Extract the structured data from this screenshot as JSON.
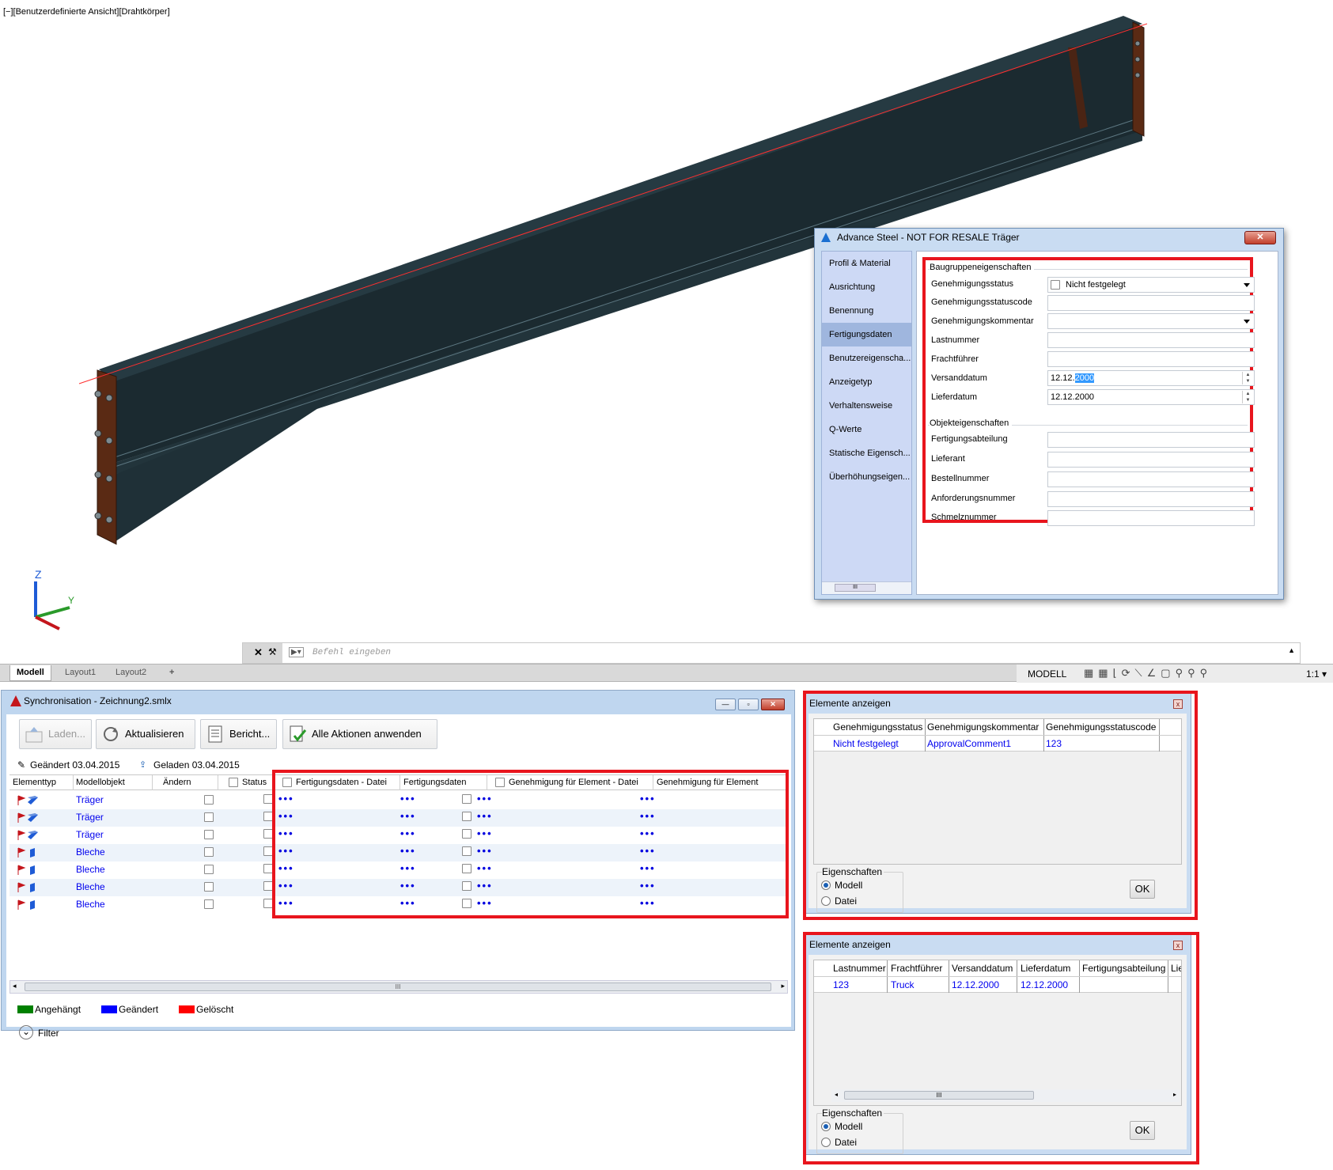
{
  "viewport": {
    "label": "[−][Benutzerdefinierte Ansicht][Drahtkörper]",
    "axis_labels": {
      "z": "Z",
      "y": "Y"
    }
  },
  "props_dialog": {
    "title": "Advance Steel - NOT FOR RESALE   Träger",
    "close": "✕",
    "nav": [
      "Profil & Material",
      "Ausrichtung",
      "Benennung",
      "Fertigungsdaten",
      "Benutzereigenscha...",
      "Anzeigetyp",
      "Verhaltensweise",
      "Q-Werte",
      "Statische Eigensch...",
      "Überhöhungseigen..."
    ],
    "nav_selected_index": 3,
    "nav_scroll_label": "III",
    "group1": "Baugruppeneigenschaften",
    "group2": "Objekteigenschaften",
    "labels": {
      "status": "Genehmigungsstatus",
      "statuscode": "Genehmigungsstatuscode",
      "comment": "Genehmigungskommentar",
      "lastnummer": "Lastnummer",
      "fracht": "Frachtführer",
      "versand": "Versanddatum",
      "liefer": "Lieferdatum",
      "abteilung": "Fertigungsabteilung",
      "lieferant": "Lieferant",
      "bestell": "Bestellnummer",
      "anforderung": "Anforderungsnummer",
      "schmelz": "Schmelznummer"
    },
    "values": {
      "status": "Nicht festgelegt",
      "versand_prefix": "12.12.",
      "versand_selected": "2000",
      "liefer": "12.12.2000"
    }
  },
  "command": {
    "placeholder": "Befehl eingeben",
    "prompt": "▶▾",
    "close": "✕"
  },
  "tabs": [
    "Modell",
    "Layout1",
    "Layout2",
    "+"
  ],
  "status_bar": {
    "mode": "MODELL",
    "scale": "1:1 ▾"
  },
  "sync": {
    "title": "Synchronisation - Zeichnung2.smlx",
    "buttons": {
      "laden": "Laden...",
      "aktualisieren": "Aktualisieren",
      "bericht": "Bericht...",
      "alle": "Alle Aktionen anwenden"
    },
    "changed": "Geändert 03.04.2015",
    "loaded": "Geladen 03.04.2015",
    "headers": {
      "elementtyp": "Elementtyp",
      "modellobjekt": "Modellobjekt",
      "aendern": "Ändern",
      "status": "Status",
      "fdatei": "Fertigungsdaten - Datei",
      "fdaten": "Fertigungsdaten",
      "gdatei": "Genehmigung für Element - Datei",
      "gelement": "Genehmigung für Element"
    },
    "rows": [
      "Träger",
      "Träger",
      "Träger",
      "Bleche",
      "Bleche",
      "Bleche",
      "Bleche"
    ],
    "dots": "•••",
    "scroll_label": "III",
    "legend": {
      "angehaengt": "Angehängt",
      "geaendert": "Geändert",
      "geloescht": "Gelöscht"
    },
    "legend_colors": {
      "angehaengt": "#008000",
      "geaendert": "#0000ff",
      "geloescht": "#ff0000"
    },
    "filter": "Filter",
    "filter_icon": "⌄"
  },
  "elements1": {
    "title": "Elemente anzeigen",
    "close": "x",
    "headers": [
      "Genehmigungsstatus",
      "Genehmigungskommentar",
      "Genehmigungsstatuscode"
    ],
    "row": [
      "Nicht festgelegt",
      "ApprovalComment1",
      "123"
    ],
    "props_label": "Eigenschaften",
    "radio_modell": "Modell",
    "radio_datei": "Datei",
    "ok": "OK"
  },
  "elements2": {
    "title": "Elemente anzeigen",
    "close": "x",
    "headers": [
      "Lastnummer",
      "Frachtführer",
      "Versanddatum",
      "Lieferdatum",
      "Fertigungsabteilung",
      "Lief"
    ],
    "row": [
      "123",
      "Truck",
      "12.12.2000",
      "12.12.2000"
    ],
    "scroll_label": "III",
    "props_label": "Eigenschaften",
    "radio_modell": "Modell",
    "radio_datei": "Datei",
    "ok": "OK"
  },
  "colors": {
    "highlight": "#e8151d",
    "beam_face": "#1b2a30",
    "endplate": "#5a2a14",
    "window_frame": "#c9dcf2"
  }
}
